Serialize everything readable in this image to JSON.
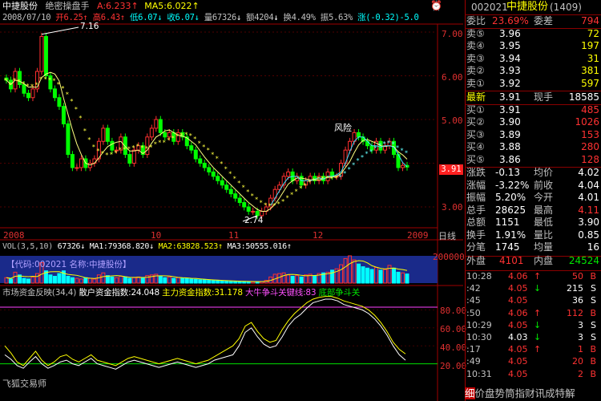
{
  "header": {
    "stock_name": "中捷股份",
    "formula": "绝密操盘手",
    "ma_a_label": "A:6.233",
    "ma5_label": "MA5:6.022",
    "top_icon": "alarm-clock-icon"
  },
  "info_line": {
    "date": "2008/07/10",
    "open": "开6.25",
    "high": "高6.43",
    "low": "低6.07",
    "close": "收6.07",
    "volume": "量67326",
    "amount": "额4204",
    "turnover": "换4.49%",
    "amplitude": "振5.63%",
    "change": "涨(-0.32)-5.0"
  },
  "price_axis": [
    "7.00",
    "6.00",
    "5.00",
    "4.00",
    "3.00"
  ],
  "current_price_tag": "3.91",
  "annotations": {
    "high_point": "7.16",
    "low_point": "2.74",
    "risk": "风险"
  },
  "time_axis": [
    "2008",
    "10",
    "11",
    "12",
    "2009"
  ],
  "period_label": "日线",
  "vol_line": {
    "title": "VOL(3,5,10)",
    "value": "67326",
    "ma1": "MA1:79368.820",
    "ma2": "MA2:63828.523",
    "ma3": "MA3:50555.016",
    "axis_value": "200000",
    "overlay_text": "【代码:002021 名称:中捷股份】"
  },
  "indicator_line": {
    "title": "市场资金反映(34,4)",
    "retail": "散户资金指数:24.048",
    "main": "主力资金指数:31.178",
    "top_line": "大牛争斗关键线:83",
    "bottom_line": "底部争斗关",
    "axis": [
      "80.00",
      "60.00",
      "40.00",
      "20.00"
    ],
    "watermark": "飞狐交易师"
  },
  "quote": {
    "code": "002021",
    "name": "中捷股份",
    "code_number": "(1409)",
    "weibi_label": "委比",
    "weibi_value": "23.69%",
    "weicha_label": "委差",
    "weicha_value": "794",
    "sell": [
      {
        "label": "卖⑤",
        "price": "3.96",
        "vol": "72"
      },
      {
        "label": "卖④",
        "price": "3.95",
        "vol": "197"
      },
      {
        "label": "卖③",
        "price": "3.94",
        "vol": "31"
      },
      {
        "label": "卖②",
        "price": "3.93",
        "vol": "381"
      },
      {
        "label": "卖①",
        "price": "3.92",
        "vol": "597"
      }
    ],
    "last_label": "最新",
    "last_price": "3.91",
    "cur_hand_label": "现手",
    "cur_hand": "18585",
    "buy": [
      {
        "label": "买①",
        "price": "3.91",
        "vol": "485"
      },
      {
        "label": "买②",
        "price": "3.90",
        "vol": "1026"
      },
      {
        "label": "买③",
        "price": "3.89",
        "vol": "153"
      },
      {
        "label": "买④",
        "price": "3.88",
        "vol": "280"
      },
      {
        "label": "买⑤",
        "price": "3.86",
        "vol": "128"
      }
    ],
    "stats": [
      {
        "l1": "涨跌",
        "v1": "-0.13",
        "l2": "均价",
        "v2": "4.02",
        "c2": "white"
      },
      {
        "l1": "涨幅",
        "v1": "-3.22%",
        "l2": "前收",
        "v2": "4.04",
        "c2": "white"
      },
      {
        "l1": "振幅",
        "v1": "5.20%",
        "l2": "今开",
        "v2": "4.01",
        "c2": "white"
      },
      {
        "l1": "总手",
        "v1": "28625",
        "l2": "最高",
        "v2": "4.11",
        "c2": "red"
      },
      {
        "l1": "总额",
        "v1": "1151",
        "l2": "最低",
        "v2": "3.90",
        "c2": "white"
      },
      {
        "l1": "换手",
        "v1": "1.91%",
        "l2": "量比",
        "v2": "0.85",
        "c2": "white"
      },
      {
        "l1": "分笔",
        "v1": "1745",
        "l2": "均量",
        "v2": "16",
        "c2": "white"
      }
    ],
    "outer_label": "外盘",
    "outer_value": "4101",
    "inner_label": "内盘",
    "inner_value": "24524",
    "ticks": [
      {
        "time": "10:28",
        "price": "4.06",
        "arrow": "↑",
        "vol": "50",
        "side": "B",
        "pc": "red",
        "vc": "red"
      },
      {
        "time": ":42",
        "price": "4.05",
        "arrow": "↓",
        "vol": "215",
        "side": "S",
        "pc": "red",
        "vc": "white"
      },
      {
        "time": ":45",
        "price": "4.05",
        "arrow": "",
        "vol": "36",
        "side": "S",
        "pc": "red",
        "vc": "white"
      },
      {
        "time": ":50",
        "price": "4.06",
        "arrow": "↑",
        "vol": "112",
        "side": "B",
        "pc": "red",
        "vc": "red"
      },
      {
        "time": "10:29",
        "price": "4.05",
        "arrow": "↓",
        "vol": "3",
        "side": "S",
        "pc": "red",
        "vc": "white"
      },
      {
        "time": "10:30",
        "price": "4.03",
        "arrow": "↓",
        "vol": "3",
        "side": "S",
        "pc": "white",
        "vc": "white"
      },
      {
        "time": ":17",
        "price": "4.05",
        "arrow": "↑",
        "vol": "1",
        "side": "B",
        "pc": "red",
        "vc": "red"
      },
      {
        "time": ":49",
        "price": "4.05",
        "arrow": "",
        "vol": "20",
        "side": "B",
        "pc": "red",
        "vc": "red"
      },
      {
        "time": "10:31",
        "price": "4.05",
        "arrow": "",
        "vol": "2",
        "side": "B",
        "pc": "red",
        "vc": "red"
      }
    ],
    "bottom_tabs": [
      "细",
      "价",
      "盘",
      "势",
      "筒",
      "指",
      "财",
      "讯",
      "成",
      "特",
      "解"
    ]
  },
  "chart_data": {
    "type": "candlestick",
    "price_axis": [
      3.0,
      4.0,
      5.0,
      6.0,
      7.0
    ],
    "ylim": [
      2.6,
      7.4
    ],
    "annotated_high": 7.16,
    "annotated_low": 2.74,
    "ma_dotted_color": "#ffff40",
    "ma_line_color": "#ffff80",
    "ma2_line_color": "#40e0ff",
    "closes": [
      5.9,
      5.7,
      6.1,
      5.8,
      5.6,
      5.5,
      5.7,
      6.1,
      6.9,
      6.0,
      5.7,
      5.5,
      5.3,
      4.9,
      4.2,
      3.9,
      3.9,
      4.1,
      3.9,
      4.0,
      4.1,
      4.5,
      4.8,
      4.5,
      4.3,
      4.3,
      4.6,
      4.2,
      4.0,
      4.3,
      4.4,
      4.2,
      4.6,
      4.8,
      5.0,
      4.7,
      4.6,
      4.7,
      4.5,
      4.7,
      4.6,
      4.4,
      4.3,
      4.1,
      4.0,
      3.9,
      3.8,
      3.7,
      3.6,
      3.5,
      3.4,
      3.3,
      3.2,
      3.1,
      3.0,
      2.9,
      2.9,
      2.8,
      2.9,
      3.0,
      3.2,
      3.4,
      3.5,
      3.7,
      3.8,
      3.6,
      3.7,
      3.5,
      3.6,
      3.7,
      3.6,
      3.7,
      3.6,
      3.8,
      3.7,
      3.7,
      4.0,
      4.3,
      4.5,
      4.7,
      4.6,
      4.5,
      4.4,
      4.3,
      4.5,
      4.3,
      4.4,
      4.5,
      4.2,
      3.9,
      3.95,
      3.91
    ],
    "volumes": [
      40,
      30,
      80,
      60,
      35,
      30,
      45,
      70,
      150,
      90,
      60,
      50,
      70,
      90,
      50,
      40,
      35,
      30,
      40,
      35,
      30,
      60,
      75,
      55,
      45,
      40,
      50,
      45,
      35,
      40,
      45,
      40,
      55,
      60,
      65,
      50,
      40,
      45,
      35,
      40,
      38,
      35,
      30,
      28,
      25,
      24,
      22,
      20,
      18,
      16,
      15,
      14,
      13,
      12,
      12,
      11,
      10,
      10,
      12,
      20,
      45,
      65,
      70,
      75,
      60,
      50,
      55,
      45,
      60,
      65,
      55,
      70,
      75,
      80,
      95,
      105,
      135,
      180,
      200,
      170,
      140,
      120,
      110,
      100,
      115,
      95,
      100,
      130,
      110,
      80,
      75,
      67
    ],
    "retail_index": [
      30,
      25,
      18,
      15,
      22,
      28,
      20,
      15,
      18,
      22,
      24,
      20,
      18,
      22,
      26,
      20,
      18,
      16,
      14,
      18,
      22,
      24,
      22,
      20,
      18,
      16,
      18,
      20,
      22,
      20,
      18,
      16,
      18,
      20,
      24,
      26,
      28,
      30,
      40,
      55,
      60,
      50,
      42,
      38,
      40,
      50,
      62,
      70,
      75,
      82,
      88,
      90,
      92,
      92,
      90,
      86,
      84,
      82,
      80,
      76,
      70,
      62,
      52,
      40,
      30,
      24
    ],
    "main_index": [
      40,
      32,
      22,
      18,
      26,
      34,
      24,
      18,
      22,
      28,
      30,
      25,
      22,
      26,
      30,
      24,
      22,
      20,
      18,
      22,
      26,
      28,
      26,
      24,
      22,
      20,
      22,
      24,
      26,
      24,
      22,
      20,
      22,
      24,
      28,
      32,
      36,
      40,
      48,
      62,
      66,
      56,
      48,
      44,
      46,
      58,
      68,
      76,
      82,
      88,
      92,
      94,
      95,
      95,
      93,
      90,
      88,
      86,
      84,
      80,
      74,
      66,
      56,
      44,
      36,
      31
    ],
    "indicator_ref_lines": {
      "top": 83,
      "bottom": 20
    }
  }
}
